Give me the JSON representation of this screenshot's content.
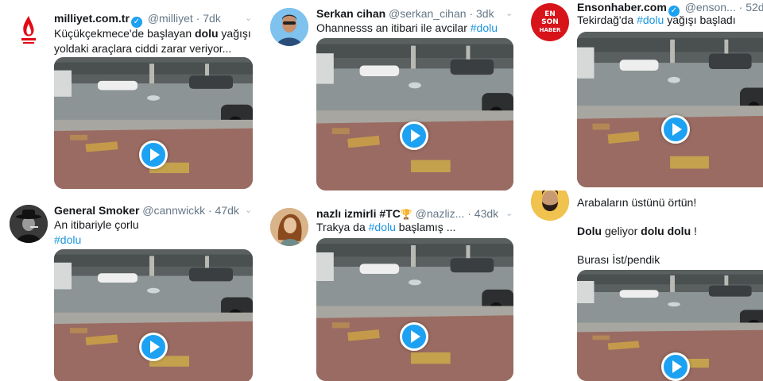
{
  "tweets": [
    {
      "name": "milliyet.com.tr",
      "handle": "@milliyet",
      "time": "7dk",
      "verified": true,
      "avatar_icon": "milliyet-flame-logo-icon",
      "text": [
        {
          "t": "Küçükçekmece'de başlayan ",
          "s": "plain"
        },
        {
          "t": "dolu",
          "s": "bold"
        },
        {
          "t": " yağışı yoldaki araçlara ciddi zarar veriyor...",
          "s": "plain"
        }
      ]
    },
    {
      "name": "Serkan cihan",
      "handle": "@serkan_cihan",
      "time": "3dk",
      "verified": false,
      "avatar_icon": "man-portrait-avatar-icon",
      "text": [
        {
          "t": "Ohannesss an itibari ile  avcilar ",
          "s": "plain"
        },
        {
          "t": "#dolu",
          "s": "hash"
        }
      ]
    },
    {
      "name": "Ensonhaber.com",
      "handle": "@enson...",
      "time": "52dk",
      "verified": true,
      "avatar_icon": "ensonhaber-logo-icon",
      "avatar_lines": [
        "EN",
        "SON",
        "HABER"
      ],
      "text": [
        {
          "t": "Tekirdağ'da ",
          "s": "plain"
        },
        {
          "t": "#dolu",
          "s": "hash"
        },
        {
          "t": " yağışı başladı",
          "s": "plain"
        }
      ]
    },
    {
      "name": "General Smoker",
      "handle": "@cannwickk",
      "time": "47dk",
      "verified": false,
      "avatar_icon": "man-in-hat-avatar-icon",
      "text": [
        {
          "t": "An itibariyle çorlu",
          "s": "plain"
        },
        {
          "t": "#dolu",
          "s": "hash-block"
        }
      ]
    },
    {
      "name": "nazlı izmirli #TC",
      "emoji": "🏆",
      "handle": "@nazliz...",
      "time": "43dk",
      "verified": false,
      "avatar_icon": "woman-portrait-avatar-icon",
      "text": [
        {
          "t": "Trakya da ",
          "s": "plain"
        },
        {
          "t": "#dolu",
          "s": "hash"
        },
        {
          "t": " başlamış ...",
          "s": "plain"
        }
      ]
    },
    {
      "name": "",
      "handle": "",
      "time": "",
      "verified": false,
      "avatar_icon": "bearded-man-avatar-icon",
      "text_lines": [
        [
          {
            "t": "Arabaların üstünü örtün!",
            "s": "plain"
          }
        ],
        [],
        [
          {
            "t": "Dolu",
            "s": "bold"
          },
          {
            "t": " geliyor ",
            "s": "plain"
          },
          {
            "t": "dolu dolu",
            "s": "bold"
          },
          {
            "t": " !",
            "s": "plain"
          }
        ],
        [],
        [
          {
            "t": "Burası İst/pendik",
            "s": "plain"
          }
        ]
      ]
    }
  ],
  "media": {
    "type": "video",
    "play_icon": "play-button-icon"
  }
}
